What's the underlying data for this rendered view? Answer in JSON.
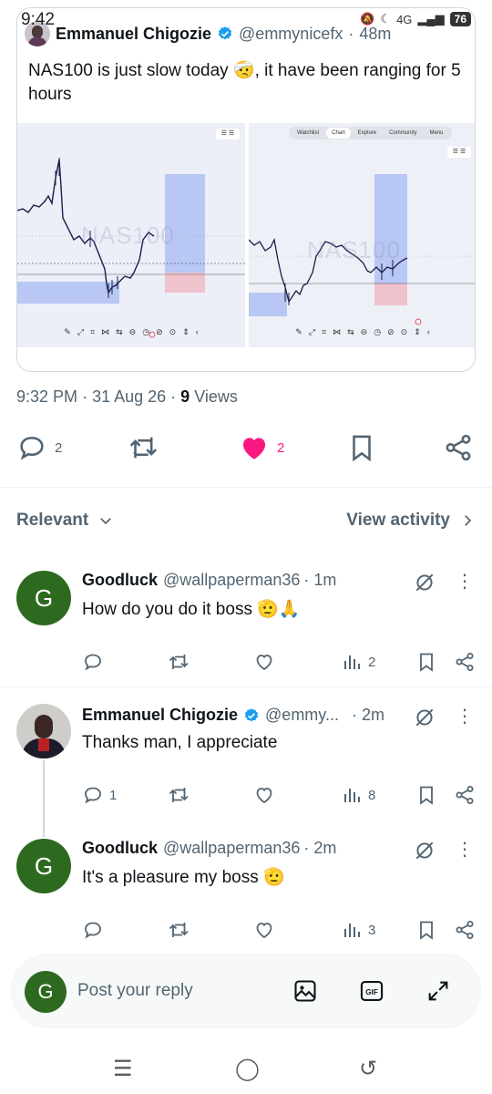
{
  "status_bar": {
    "time": "9:42",
    "network": "4G",
    "battery": "76"
  },
  "quoted": {
    "author_name": "Emmanuel Chigozie",
    "author_handle": "@emmynicefx",
    "separator": "·",
    "age": "48m",
    "text": "NAS100 is just slow today 🤕, it have been ranging for 5 hours",
    "chart_watermark": "NAS100",
    "tv_nav": [
      "Watchlist",
      "Chart",
      "Explore",
      "Community",
      "Menu"
    ]
  },
  "meta": {
    "time": "9:32 PM",
    "date": "31 Aug 26",
    "views_count": "9",
    "views_label": "Views"
  },
  "actions": {
    "replies": "2",
    "likes": "2"
  },
  "sort": {
    "relevant": "Relevant",
    "view_activity": "View activity"
  },
  "replies": [
    {
      "avatar_letter": "G",
      "name": "Goodluck",
      "handle": "@wallpaperman36",
      "time": "· 1m",
      "text": "How do you do it boss 🫡🙏",
      "reply_count": "",
      "views": "2"
    },
    {
      "avatar_letter": "",
      "name": "Emmanuel Chigozie",
      "handle": "@emmy...",
      "time": "· 2m",
      "text": "Thanks man, I appreciate",
      "reply_count": "1",
      "views": "8"
    },
    {
      "avatar_letter": "G",
      "name": "Goodluck",
      "handle": "@wallpaperman36",
      "time": "· 2m",
      "text": "It's a pleasure my boss 🫡",
      "reply_count": "",
      "views": "3"
    }
  ],
  "composer": {
    "avatar_letter": "G",
    "placeholder": "Post your reply",
    "gif_label": "GIF"
  },
  "colors": {
    "like": "#f91880",
    "verified": "#1d9bf0",
    "avatar_green": "#2d6a1f"
  }
}
